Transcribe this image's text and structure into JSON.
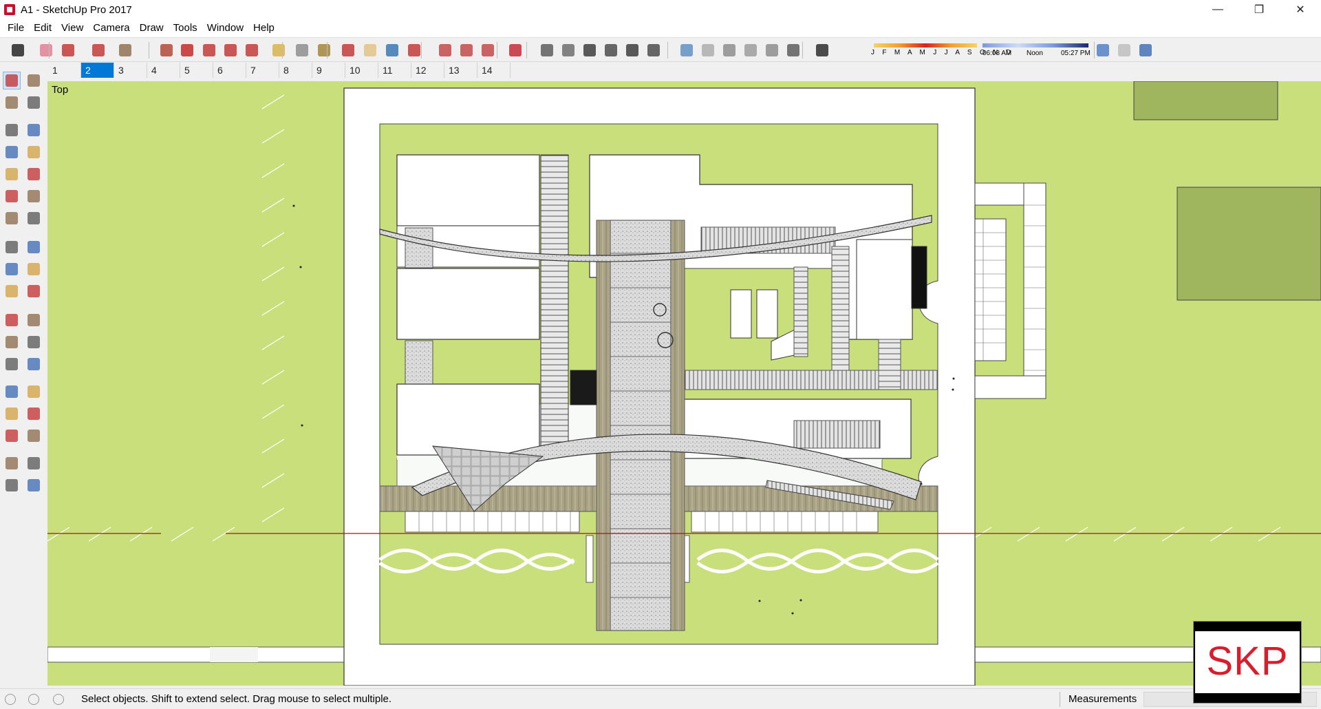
{
  "window": {
    "title": "A1 - SketchUp Pro 2017",
    "controls": [
      {
        "name": "minimize-button",
        "glyph": "—"
      },
      {
        "name": "restore-button",
        "glyph": "❐"
      },
      {
        "name": "close-button",
        "glyph": "✕"
      }
    ]
  },
  "menu": [
    "File",
    "Edit",
    "View",
    "Camera",
    "Draw",
    "Tools",
    "Window",
    "Help"
  ],
  "toolbar": {
    "icons": [
      "select-icon",
      "eraser-icon",
      "line-icon",
      "arc-icon",
      "rectangle-icon",
      "push-pull-icon",
      "follow-me-icon",
      "move-icon",
      "rotate-icon",
      "scale-icon",
      "tape-measure-icon",
      "text-icon",
      "paint-bucket-icon",
      "orbit-icon",
      "pan-icon",
      "zoom-icon",
      "zoom-extents-icon",
      "warehouse-icon",
      "extension-warehouse-icon",
      "layout-icon",
      "ruby-icon",
      "iso-view-icon",
      "top-view-icon",
      "front-view-icon",
      "right-view-icon",
      "back-view-icon",
      "left-view-icon",
      "xray-icon",
      "back-edges-icon",
      "wireframe-icon",
      "hidden-line-icon",
      "shaded-icon",
      "shaded-textures-icon",
      "shadows-icon",
      "geo-location-icon",
      "fog-icon",
      "add-location-icon"
    ],
    "shadow": {
      "months": "J F M A M J J A S O N D",
      "time_start": "06:08 AM",
      "time_mid": "Noon",
      "time_end": "05:27 PM"
    }
  },
  "scenes": [
    "1",
    "2",
    "3",
    "4",
    "5",
    "6",
    "7",
    "8",
    "9",
    "10",
    "11",
    "12",
    "13",
    "14"
  ],
  "active_scene": "2",
  "left_tools": [
    [
      "select-icon",
      "component-icon"
    ],
    [
      "paint-bucket-icon",
      "eraser-icon"
    ],
    [
      "line-icon",
      "freehand-icon"
    ],
    [
      "rectangle-icon",
      "rotated-rectangle-icon"
    ],
    [
      "circle-icon",
      "polygon-icon"
    ],
    [
      "arc-icon",
      "two-point-arc-icon"
    ],
    [
      "three-point-arc-icon",
      "pie-icon"
    ],
    [
      "move-icon",
      "push-pull-icon"
    ],
    [
      "rotate-icon",
      "follow-me-icon"
    ],
    [
      "scale-icon",
      "offset-icon"
    ],
    [
      "tape-measure-icon",
      "dimension-icon"
    ],
    [
      "protractor-icon",
      "text-icon"
    ],
    [
      "axes-icon",
      "3d-text-icon"
    ],
    [
      "orbit-icon",
      "pan-icon"
    ],
    [
      "zoom-icon",
      "zoom-window-icon"
    ],
    [
      "zoom-extents-icon",
      "previous-view-icon"
    ],
    [
      "position-camera-icon",
      "look-around-icon"
    ],
    [
      "walk-icon",
      "section-plane-icon"
    ]
  ],
  "viewport": {
    "view_label": "Top",
    "background_color": "#c8df7b"
  },
  "status": {
    "message": "Select objects. Shift to extend select. Drag mouse to select multiple.",
    "measurements_label": "Measurements",
    "measurements_value": ""
  },
  "badge": {
    "text": "SKP",
    "color": "#d81e2c"
  }
}
